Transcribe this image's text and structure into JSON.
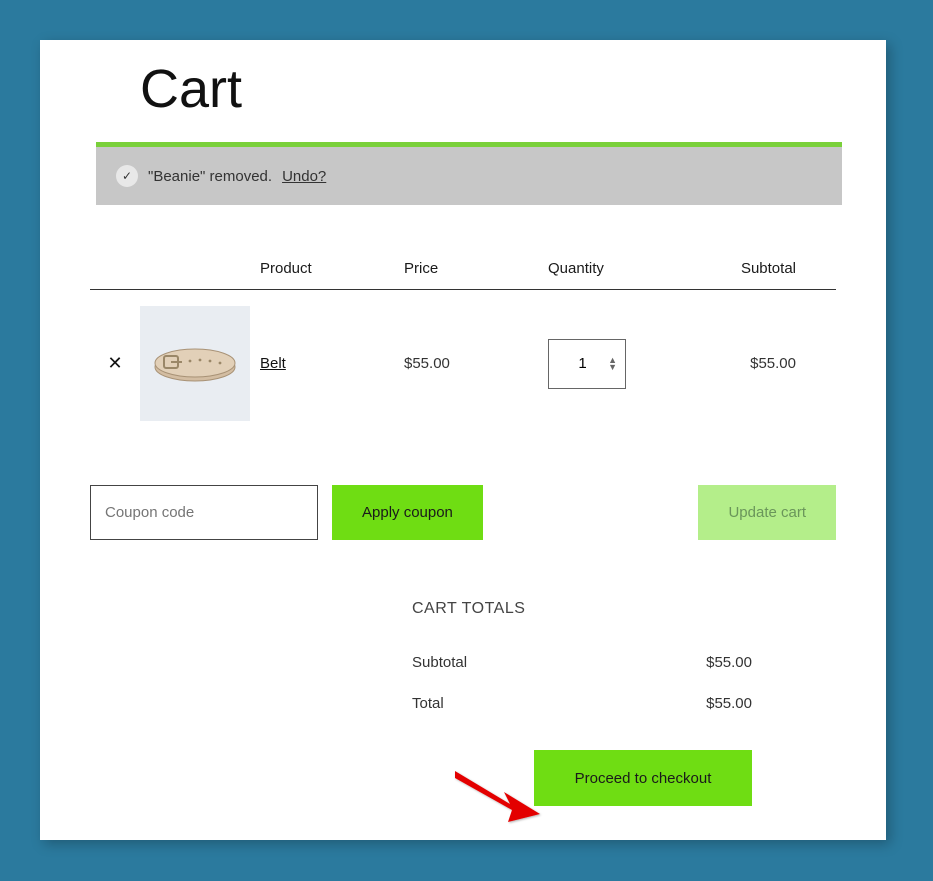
{
  "page_title": "Cart",
  "notice": {
    "text": "\"Beanie\" removed.",
    "undo_label": "Undo?"
  },
  "columns": {
    "product": "Product",
    "price": "Price",
    "quantity": "Quantity",
    "subtotal": "Subtotal"
  },
  "cart_item": {
    "name": "Belt",
    "price": "$55.00",
    "quantity": "1",
    "subtotal": "$55.00"
  },
  "coupon": {
    "placeholder": "Coupon code",
    "apply_label": "Apply coupon"
  },
  "update_cart_label": "Update cart",
  "totals": {
    "title": "CART TOTALS",
    "subtotal_label": "Subtotal",
    "subtotal_value": "$55.00",
    "total_label": "Total",
    "total_value": "$55.00"
  },
  "checkout_label": "Proceed to checkout",
  "colors": {
    "accent": "#6fdd13",
    "accent_light": "#b4ee8a",
    "page_bg": "#2B7A9E"
  }
}
